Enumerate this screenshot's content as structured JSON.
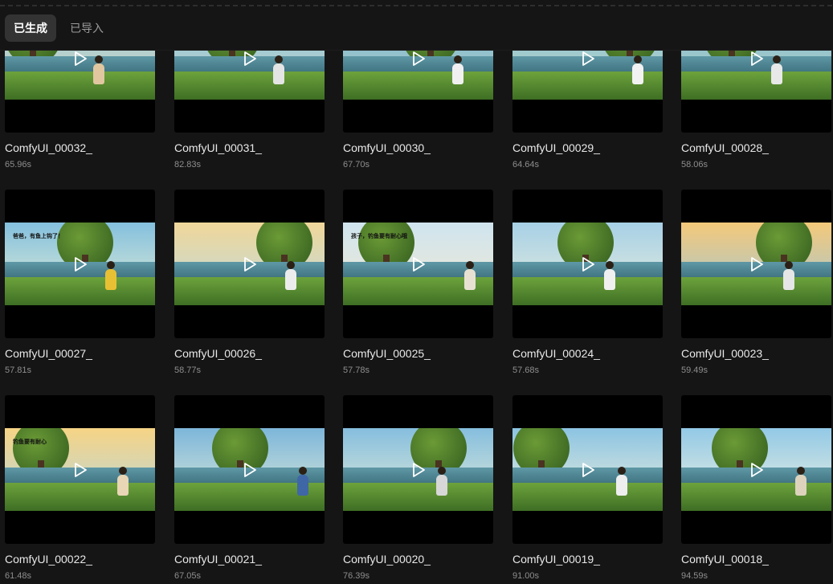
{
  "tabs": [
    {
      "label": "已生成",
      "active": true
    },
    {
      "label": "已导入",
      "active": false
    }
  ],
  "accent_color": "#333333",
  "items": [
    {
      "name": "ComfyUI_00032_",
      "duration": "65.96s",
      "sky": [
        "#8fc1d6",
        "#e8e2c2"
      ],
      "figure": "#e0c7a0"
    },
    {
      "name": "ComfyUI_00031_",
      "duration": "82.83s",
      "sky": [
        "#7fb7d4",
        "#d9e6cf"
      ],
      "figure": "#e4e4e4"
    },
    {
      "name": "ComfyUI_00030_",
      "duration": "67.70s",
      "sky": [
        "#6aa9c9",
        "#c9e0d0"
      ],
      "figure": "#f0f0f0"
    },
    {
      "name": "ComfyUI_00029_",
      "duration": "64.64s",
      "sky": [
        "#7ab6d2",
        "#d2e4c8"
      ],
      "figure": "#f2f2f2"
    },
    {
      "name": "ComfyUI_00028_",
      "duration": "58.06s",
      "sky": [
        "#6fb0cf",
        "#cfe0c7"
      ],
      "figure": "#e8e8e8"
    },
    {
      "name": "ComfyUI_00027_",
      "duration": "57.81s",
      "sky": [
        "#84c0de",
        "#e5efd6"
      ],
      "figure": "#e8c034",
      "bubble": "爸爸，有鱼上钩了！"
    },
    {
      "name": "ComfyUI_00026_",
      "duration": "58.77s",
      "sky": [
        "#f0d79a",
        "#bcd9de"
      ],
      "figure": "#ececec"
    },
    {
      "name": "ComfyUI_00025_",
      "duration": "57.78s",
      "sky": [
        "#cfe4ef",
        "#f2ead2"
      ],
      "figure": "#e8e1d2",
      "bubble": "孩子，钓鱼要有耐心哦"
    },
    {
      "name": "ComfyUI_00024_",
      "duration": "57.68s",
      "sky": [
        "#a7d0e6",
        "#e8eedd"
      ],
      "figure": "#f0f0f0"
    },
    {
      "name": "ComfyUI_00023_",
      "duration": "59.49s",
      "sky": [
        "#f4c97a",
        "#9fc6d8"
      ],
      "figure": "#e6e6e6"
    },
    {
      "name": "ComfyUI_00022_",
      "duration": "61.48s",
      "sky": [
        "#f6d485",
        "#b6d6e0"
      ],
      "figure": "#e8d6b5",
      "bubble": "钓鱼要有耐心"
    },
    {
      "name": "ComfyUI_00021_",
      "duration": "67.05s",
      "sky": [
        "#7db6da",
        "#e1ecd8"
      ],
      "figure": "#3f67a6"
    },
    {
      "name": "ComfyUI_00020_",
      "duration": "76.39s",
      "sky": [
        "#86bede",
        "#e4edd9"
      ],
      "figure": "#d7d7d7"
    },
    {
      "name": "ComfyUI_00019_",
      "duration": "91.00s",
      "sky": [
        "#8cc4e2",
        "#eef0de"
      ],
      "figure": "#eeeeee"
    },
    {
      "name": "ComfyUI_00018_",
      "duration": "94.59s",
      "sky": [
        "#93c9e6",
        "#f0f2e1"
      ],
      "figure": "#ddd3bd"
    }
  ]
}
